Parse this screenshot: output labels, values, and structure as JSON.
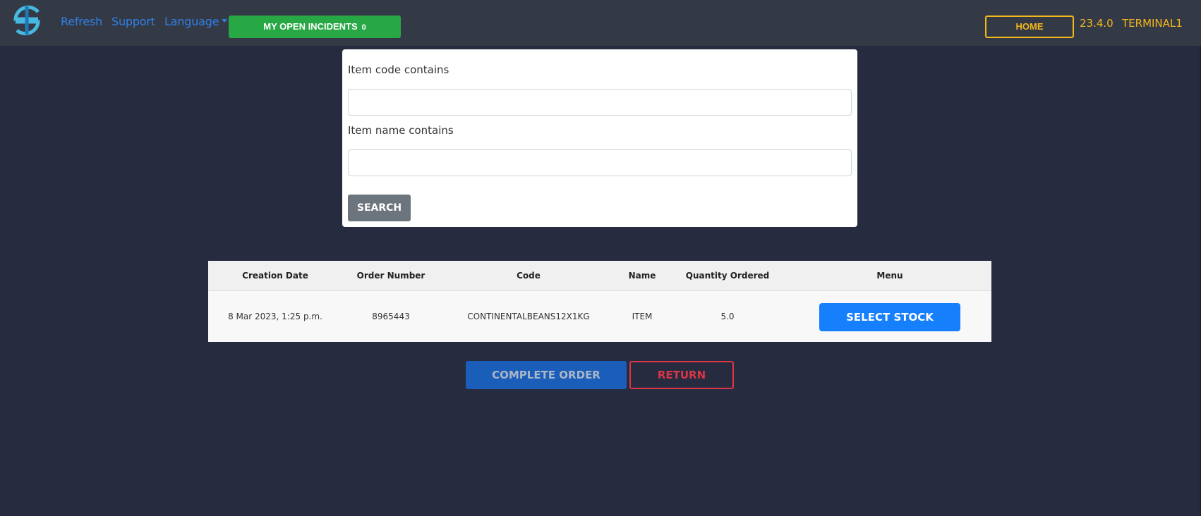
{
  "header": {
    "logo": "app-logo",
    "nav_links": {
      "refresh": "Refresh",
      "support": "Support",
      "language": "Language"
    },
    "incidents_button": {
      "label": "MY OPEN INCIDENTS",
      "count": "0"
    },
    "home_button": "HOME",
    "version": "23.4.0",
    "terminal": "TERMINAL1"
  },
  "search": {
    "item_code_label": "Item code contains",
    "item_code_value": "",
    "item_name_label": "Item name contains",
    "item_name_value": "",
    "search_button": "SEARCH"
  },
  "orders_table": {
    "columns": [
      "Creation Date",
      "Order Number",
      "Code",
      "Name",
      "Quantity Ordered",
      "Menu"
    ],
    "rows": [
      {
        "creation_date": "8 Mar 2023, 1:25 p.m.",
        "order_number": "8965443",
        "code": "CONTINENTALBEANS12X1KG",
        "name": "ITEM",
        "quantity_ordered": "5.0",
        "menu_button": "SELECT STOCK"
      }
    ]
  },
  "actions": {
    "complete_order": "COMPLETE ORDER",
    "return": "RETURN"
  },
  "colors": {
    "background": "#262b40",
    "navbar": "#343a45",
    "link": "#2f7fe6",
    "success": "#28a745",
    "warning": "#f4b81c",
    "primary": "#167ffc",
    "danger": "#dc3545",
    "secondary": "#6c757d"
  }
}
